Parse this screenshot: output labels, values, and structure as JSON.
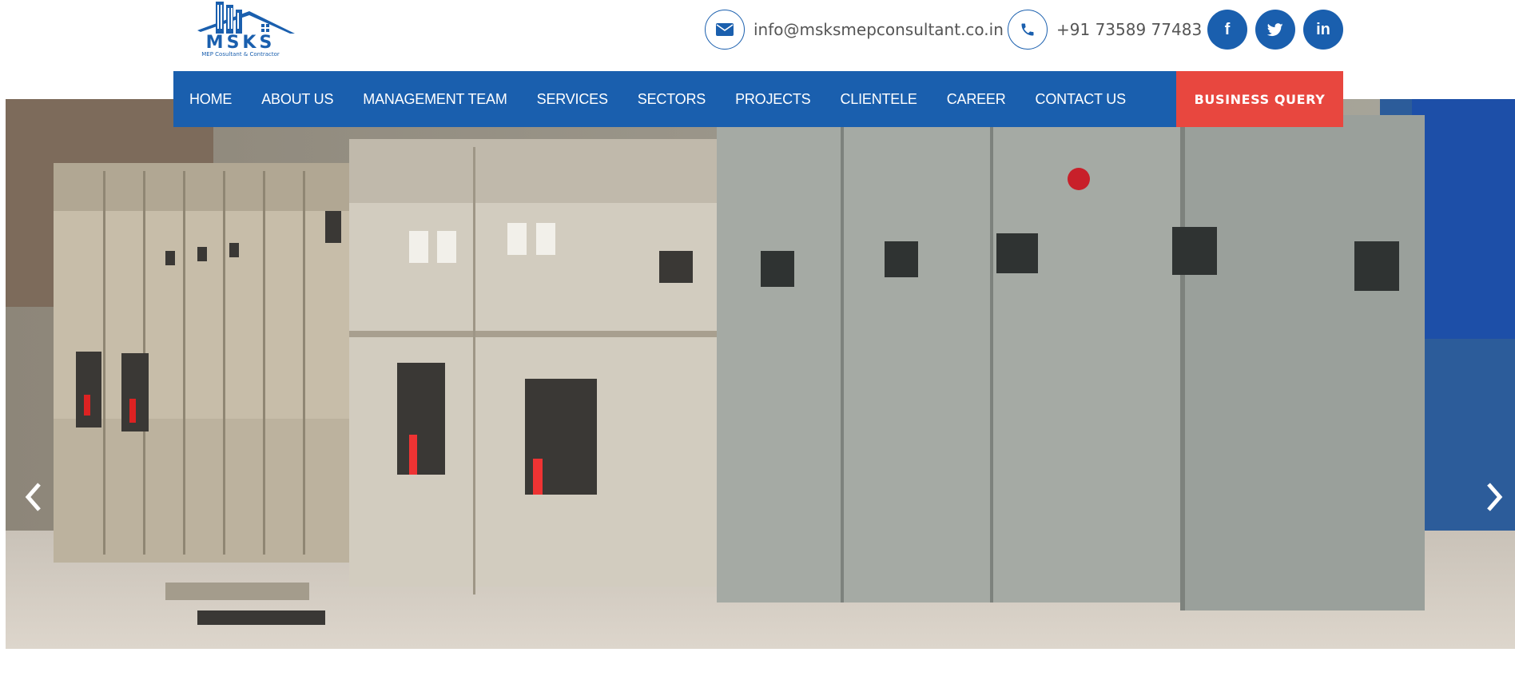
{
  "brand": {
    "logo_text": "MSKS",
    "tagline": "MEP Cosultant & Contractor",
    "color": "#1a5fae"
  },
  "contact": {
    "email": "info@msksmepconsultant.co.in",
    "email_icon": "envelope-icon",
    "phone": "+91 73589 77483",
    "phone_icon": "phone-icon"
  },
  "social": [
    {
      "label": "f",
      "icon": "facebook-icon"
    },
    {
      "label": "t",
      "icon": "twitter-icon"
    },
    {
      "label": "in",
      "icon": "linkedin-icon"
    }
  ],
  "nav": {
    "items": [
      "HOME",
      "ABOUT US",
      "MANAGEMENT TEAM",
      "SERVICES",
      "SECTORS",
      "PROJECTS",
      "CLIENTELE",
      "CAREER",
      "CONTACT US"
    ],
    "cta": "BUSINESS QUERY",
    "bg_color": "#1a5fae",
    "cta_color": "#e8473f"
  },
  "hero": {
    "prev_icon": "chevron-left-icon",
    "next_icon": "chevron-right-icon"
  }
}
